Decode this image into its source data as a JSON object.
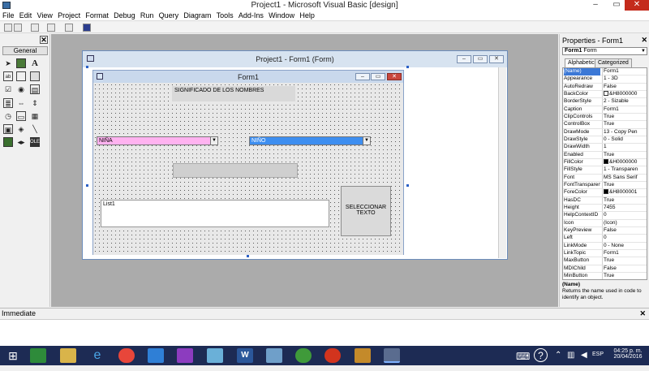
{
  "window": {
    "title": "Project1 - Microsoft Visual Basic [design]",
    "min": "–",
    "max": "▭",
    "close": "✕"
  },
  "menu": [
    "File",
    "Edit",
    "View",
    "Project",
    "Format",
    "Debug",
    "Run",
    "Query",
    "Diagram",
    "Tools",
    "Add-Ins",
    "Window",
    "Help"
  ],
  "toolbox": {
    "close": "✕",
    "tab": "General",
    "tools": [
      "pointer",
      "picturebox",
      "label",
      "textbox",
      "frame",
      "commandbutton",
      "checkbox",
      "optionbutton",
      "combobox",
      "listbox",
      "hscrollbar",
      "vscrollbar",
      "timer",
      "drivelistbox",
      "dirlistbox",
      "filelistbox",
      "shape",
      "line",
      "image",
      "data",
      "ole"
    ]
  },
  "project_window": {
    "title": "Project1 - Form1 (Form)",
    "form": {
      "title": "Form1",
      "label_top": "SIGNIFICADO DE LOS NOMBRES",
      "combo_girl": "NIÑA",
      "combo_boy": "NIÑO",
      "list": "List1",
      "button": "SELECCIONAR TEXTO",
      "colors": {
        "girl": "#ffb3f0",
        "boy": "#3d8ef0"
      }
    }
  },
  "properties": {
    "title": "Properties - Form1",
    "close": "✕",
    "object_bold": "Form1",
    "object_type": "Form",
    "tabs": [
      "Alphabetic",
      "Categorized"
    ],
    "rows": [
      {
        "name": "(Name)",
        "value": "Form1"
      },
      {
        "name": "Appearance",
        "value": "1 - 3D"
      },
      {
        "name": "AutoRedraw",
        "value": "False"
      },
      {
        "name": "BackColor",
        "value": "&H8000000",
        "swatch": "#ffffff"
      },
      {
        "name": "BorderStyle",
        "value": "2 - Sizable"
      },
      {
        "name": "Caption",
        "value": "Form1"
      },
      {
        "name": "ClipControls",
        "value": "True"
      },
      {
        "name": "ControlBox",
        "value": "True"
      },
      {
        "name": "DrawMode",
        "value": "13 - Copy Pen"
      },
      {
        "name": "DrawStyle",
        "value": "0 - Solid"
      },
      {
        "name": "DrawWidth",
        "value": "1"
      },
      {
        "name": "Enabled",
        "value": "True"
      },
      {
        "name": "FillColor",
        "value": "&H0000000",
        "swatch": "#000000"
      },
      {
        "name": "FillStyle",
        "value": "1 - Transparen"
      },
      {
        "name": "Font",
        "value": "MS Sans Serif"
      },
      {
        "name": "FontTransparen",
        "value": "True"
      },
      {
        "name": "ForeColor",
        "value": "&H8000001",
        "swatch": "#000000"
      },
      {
        "name": "HasDC",
        "value": "True"
      },
      {
        "name": "Height",
        "value": "7455"
      },
      {
        "name": "HelpContextID",
        "value": "0"
      },
      {
        "name": "Icon",
        "value": "(Icon)"
      },
      {
        "name": "KeyPreview",
        "value": "False"
      },
      {
        "name": "Left",
        "value": "0"
      },
      {
        "name": "LinkMode",
        "value": "0 - None"
      },
      {
        "name": "LinkTopic",
        "value": "Form1"
      },
      {
        "name": "MaxButton",
        "value": "True"
      },
      {
        "name": "MDIChild",
        "value": "False"
      },
      {
        "name": "MinButton",
        "value": "True"
      }
    ],
    "desc_title": "(Name)",
    "desc_text": "Returns the name used in code to identify an object."
  },
  "immediate": {
    "title": "Immediate",
    "close": "✕"
  },
  "taskbar": {
    "time": "04:25 p. m.",
    "date": "20/04/2016",
    "lang": "ESP"
  }
}
